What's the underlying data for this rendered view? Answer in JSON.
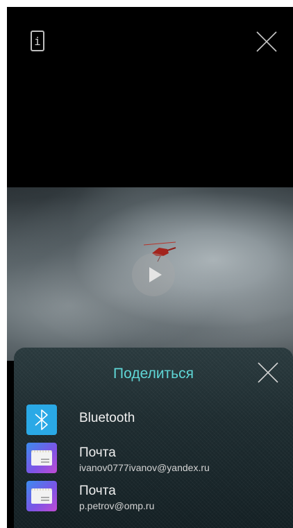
{
  "viewer": {
    "info_icon": "info-icon",
    "close_icon": "close-icon",
    "info_glyph": "i"
  },
  "video": {
    "play_icon": "play-icon"
  },
  "share": {
    "title": "Поделиться",
    "close_icon": "close-icon",
    "items": [
      {
        "icon": "bluetooth-icon",
        "label": "Bluetooth",
        "detail": ""
      },
      {
        "icon": "mail-icon",
        "label": "Почта",
        "detail": "ivanov0777ivanov@yandex.ru"
      },
      {
        "icon": "mail-icon",
        "label": "Почта",
        "detail": "p.petrov@omp.ru"
      }
    ]
  },
  "colors": {
    "accent": "#5fd6d6",
    "bluetooth": "#2aa9e6",
    "background": "#000000"
  }
}
